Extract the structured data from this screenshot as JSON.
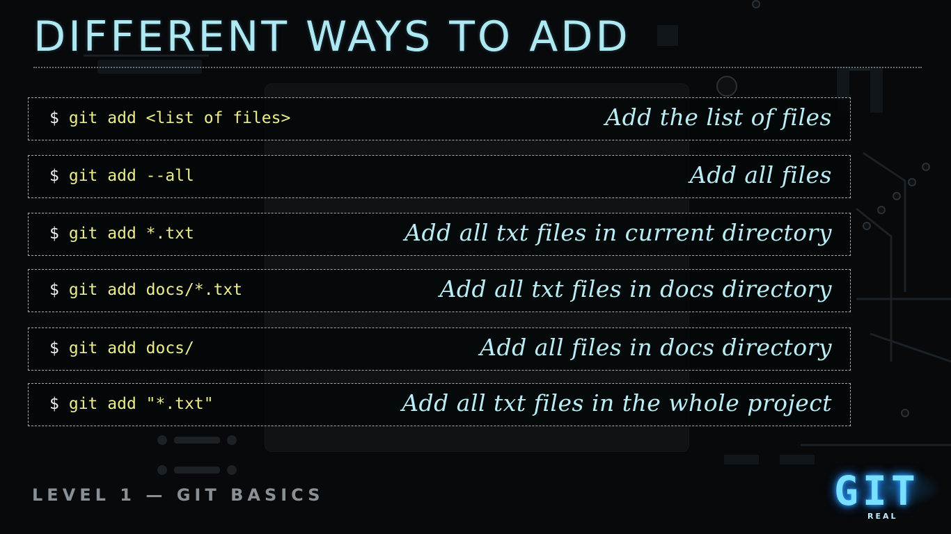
{
  "slide": {
    "title": "DIFFERENT WAYS TO ADD",
    "level_label": "LEVEL 1 — GIT BASICS"
  },
  "commands": [
    {
      "prompt": "$",
      "command": "git add <list of files>",
      "description": "Add the list of files"
    },
    {
      "prompt": "$",
      "command": "git add --all",
      "description": "Add all files"
    },
    {
      "prompt": "$",
      "command": "git add *.txt",
      "description": "Add all txt files in current directory"
    },
    {
      "prompt": "$",
      "command": "git add docs/*.txt",
      "description": "Add all txt files in docs directory"
    },
    {
      "prompt": "$",
      "command": "git add docs/",
      "description": "Add all files in docs directory"
    },
    {
      "prompt": "$",
      "command": "git add \"*.txt\"",
      "description": "Add all txt files in the whole project"
    }
  ],
  "logo": {
    "text": "GIT",
    "subtext": "REAL"
  },
  "colors": {
    "background": "#07090b",
    "title": "#aee8f2",
    "command_text": "#ecec8c",
    "description_text": "#b9eef6",
    "logo_glow": "#2fa8ff"
  }
}
